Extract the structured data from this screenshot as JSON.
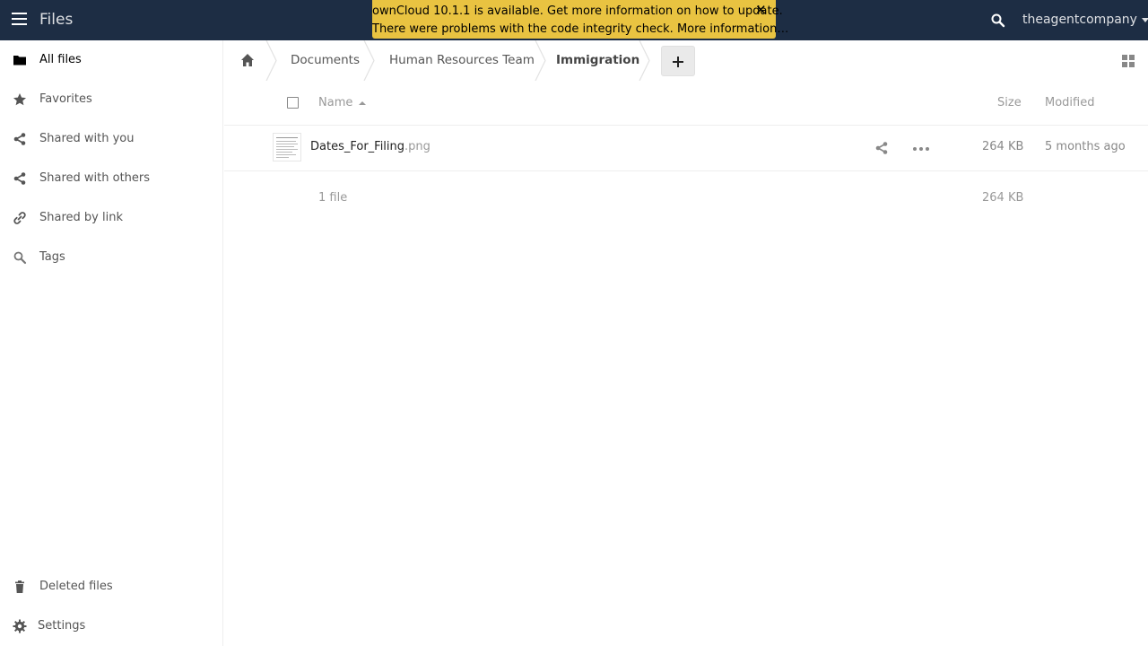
{
  "header": {
    "app_title": "Files",
    "user_name": "theagentcompany"
  },
  "notification": {
    "update_message": "ownCloud 10.1.1 is available. Get more information on how to update.",
    "integrity_message": "There were problems with the code integrity check. More information…",
    "close_glyph": "✕"
  },
  "sidebar": {
    "items": [
      {
        "label": "All files",
        "icon": "folder-icon",
        "active": true
      },
      {
        "label": "Favorites",
        "icon": "star-icon"
      },
      {
        "label": "Shared with you",
        "icon": "share-icon"
      },
      {
        "label": "Shared with others",
        "icon": "share-icon"
      },
      {
        "label": "Shared by link",
        "icon": "link-icon"
      },
      {
        "label": "Tags",
        "icon": "tag-search-icon"
      }
    ],
    "bottom": [
      {
        "label": "Deleted files",
        "icon": "trash-icon"
      },
      {
        "label": "Settings",
        "icon": "gear-icon"
      }
    ]
  },
  "breadcrumb": {
    "items": [
      "Documents",
      "Human Resources Team",
      "Immigration"
    ]
  },
  "table": {
    "headers": {
      "name": "Name",
      "size": "Size",
      "modified": "Modified"
    },
    "rows": [
      {
        "name": "Dates_For_Filing",
        "ext": ".png",
        "size": "264 KB",
        "modified": "5 months ago"
      }
    ],
    "summary": {
      "count": "1 file",
      "size": "264 KB"
    }
  },
  "colors": {
    "header_bg": "#1d2d44",
    "notification_bg": "#e9c341"
  }
}
